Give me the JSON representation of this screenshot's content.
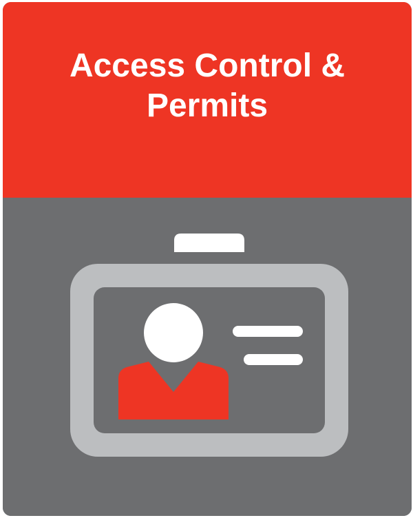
{
  "tile": {
    "title_line1": "Access Control &",
    "title_line2": "Permits",
    "icon": "id-badge-icon",
    "colors": {
      "header": "#ee3524",
      "body": "#6d6e70",
      "badge_frame": "#bcbec0",
      "badge_card": "#6d6e70",
      "person_head": "#ffffff",
      "person_shirt": "#ee3524",
      "text_lines": "#ffffff"
    }
  }
}
